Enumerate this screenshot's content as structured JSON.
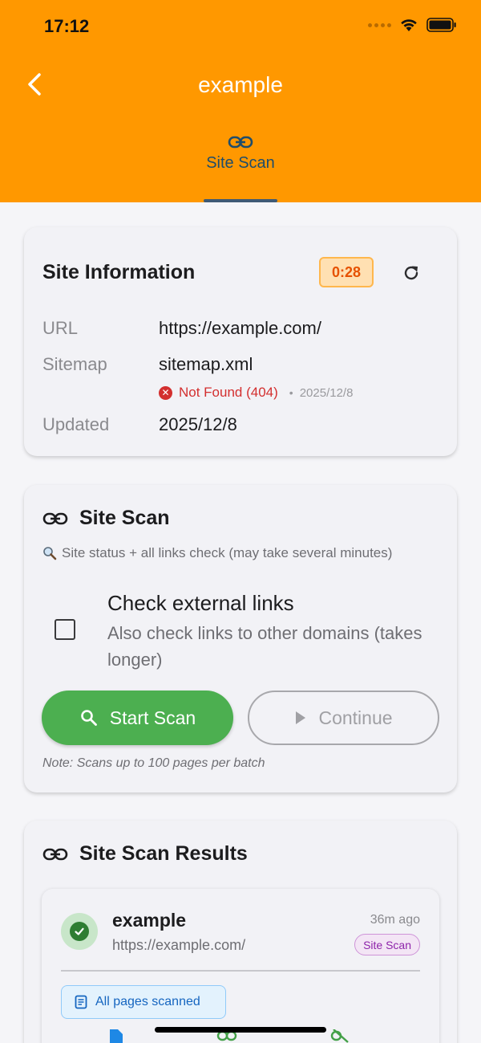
{
  "status_bar": {
    "time": "17:12"
  },
  "header": {
    "title": "example",
    "tab_label": "Site Scan"
  },
  "site_info": {
    "title": "Site Information",
    "timer": "0:28",
    "url_label": "URL",
    "url_value": "https://example.com/",
    "sitemap_label": "Sitemap",
    "sitemap_value": "sitemap.xml",
    "sitemap_status": "Not Found (404)",
    "sitemap_sep": "•",
    "sitemap_date": "2025/12/8",
    "updated_label": "Updated",
    "updated_value": "2025/12/8"
  },
  "site_scan": {
    "title": "Site Scan",
    "subtitle": "Site status + all links check (may take several minutes)",
    "external_title": "Check external links",
    "external_desc": "Also check links to other domains (takes longer)",
    "external_checked": false,
    "start_label": "Start Scan",
    "continue_label": "Continue",
    "note": "Note: Scans up to 100 pages per batch"
  },
  "results": {
    "title": "Site Scan Results",
    "item": {
      "name": "example",
      "url": "https://example.com/",
      "time": "36m ago",
      "tag": "Site Scan",
      "pages_badge": "All pages scanned"
    }
  },
  "colors": {
    "header": "#ff9800",
    "success": "#4caf50",
    "error": "#d32f2f",
    "timer": "#e65100"
  }
}
